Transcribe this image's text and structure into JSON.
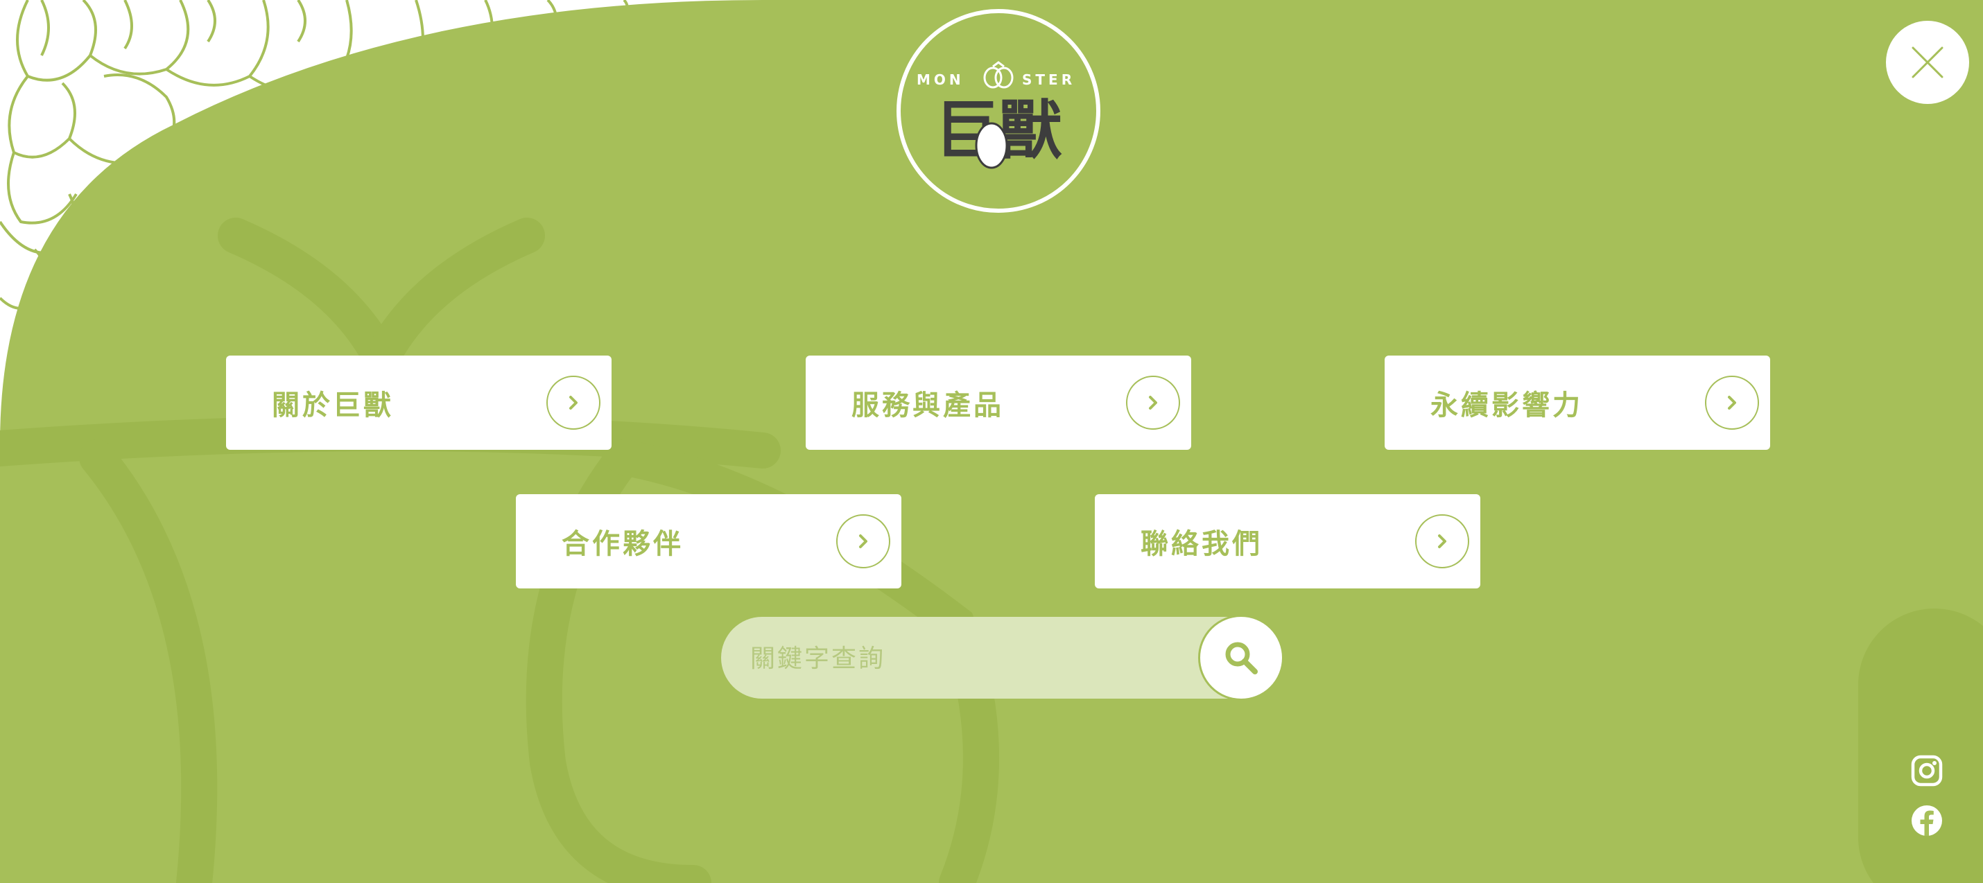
{
  "brand": {
    "logo_top_text_left": "MON",
    "logo_top_text_right": "STER",
    "logo_main_text": "巨獸",
    "logo_icon": "monster-logo-icon"
  },
  "header": {
    "close_icon": "close-icon"
  },
  "nav": {
    "items": [
      {
        "label": "關於巨獸",
        "icon": "chevron-right-icon"
      },
      {
        "label": "服務與產品",
        "icon": "chevron-right-icon"
      },
      {
        "label": "永續影響力",
        "icon": "chevron-right-icon"
      },
      {
        "label": "合作夥伴",
        "icon": "chevron-right-icon"
      },
      {
        "label": "聯絡我們",
        "icon": "chevron-right-icon"
      }
    ]
  },
  "search": {
    "placeholder": "關鍵字查詢",
    "value": "",
    "icon": "search-icon"
  },
  "social": {
    "instagram_icon": "instagram-icon",
    "facebook_icon": "facebook-icon"
  },
  "colors": {
    "primary_green": "#a6bf59",
    "dark_green": "#9db74e",
    "logo_dark": "#3d3d3d",
    "white": "#ffffff"
  }
}
